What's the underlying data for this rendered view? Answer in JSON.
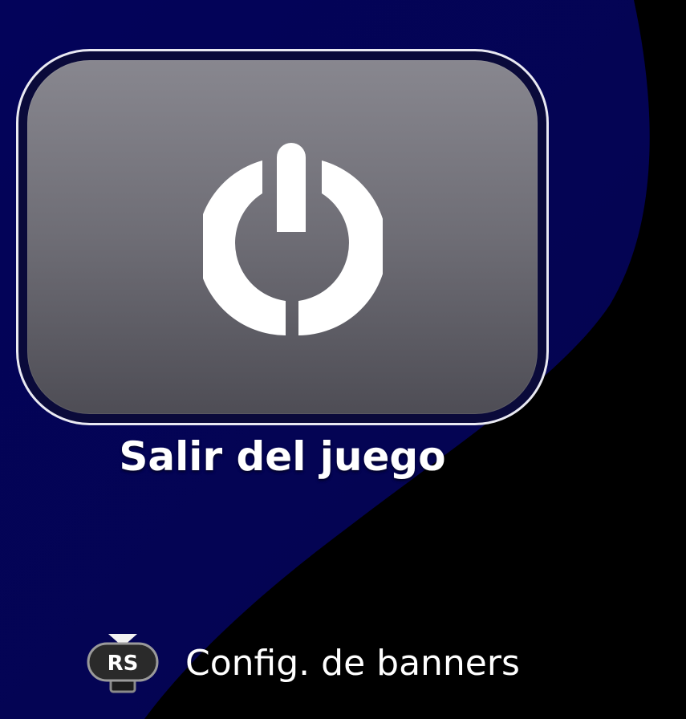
{
  "colors": {
    "background": "#000000",
    "blue_shape": "#040459",
    "tile_top": "#88878f",
    "tile_bottom": "#4e4d55",
    "tile_border": "#e9e9f2",
    "icon": "#ffffff",
    "text": "#ffffff"
  },
  "exit_tile": {
    "icon": "power-icon",
    "label": "Salir del juego"
  },
  "footer": {
    "button_icon": "right-stick-button-icon",
    "button_text": "RS",
    "label": "Config. de banners"
  }
}
